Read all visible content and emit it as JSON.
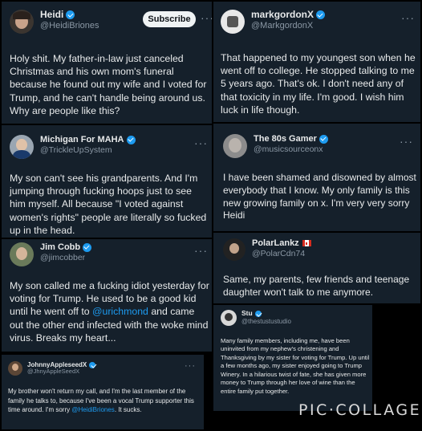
{
  "tweets": [
    {
      "name": "Heidi",
      "handle": "@HeidiBriones",
      "subscribe": "Subscribe",
      "text": "Holy shit. My father-in-law just canceled Christmas and his own mom's funeral because he found out my wife and I voted for Trump, and he can't handle being around us. Why are people like this?"
    },
    {
      "name": "markgordonX",
      "handle": "@MarkgordonX",
      "text": "That happened to my youngest son when he went off to college. He stopped talking to me 5 years ago. That's ok. I don't need any of that toxicity in my life. I'm good. I wish him luck in life though."
    },
    {
      "name": "Michigan For MAHA",
      "handle": "@TrickleUpSystem",
      "text": "My son can't see his grandparents. And I'm jumping through fucking hoops just to see him myself. All because \"I voted against women's rights\" people are literally so fucked up in the head."
    },
    {
      "name": "The 80s Gamer",
      "handle": "@musicsourceonx",
      "text": "I have been shamed and disowned by almost everybody that I know. My only family is this new growing family on x. I'm very very sorry Heidi"
    },
    {
      "name": "Jim Cobb",
      "handle": "@jimcobber",
      "text_before": "My son called me a fucking idiot yesterday for voting for Trump. He used to be a good kid until he went off to ",
      "mention": "@urichmond",
      "text_after": " and came out the other end infected with the woke mind virus. Breaks my heart..."
    },
    {
      "name": "PolarLankz",
      "handle": "@PolarCdn74",
      "text": "Same, my parents, few friends and teenage daughter won't talk to me anymore."
    },
    {
      "name": "Stu",
      "handle": "@thestustustudio",
      "text": "Many family members, including me, have been uninvited from my nephew's christening and Thanksgiving by my sister for voting for Trump. Up until a few months ago, my sister enjoyed going to Trump Winery. In a hilarious twist of fate, she has given more money to Trump through her love of wine than the entire family put together."
    },
    {
      "name": "JohnnyAppleseedX",
      "handle": "@JhnyAppleSeedX",
      "text_before": "My brother won't return my call, and I'm the last member of the family he talks to, because I've been a vocal Trump supporter this time around. I'm sorry ",
      "mention": "@HeidiBriones",
      "text_after": ". It sucks."
    }
  ],
  "more_glyph": "···",
  "watermark": "PIC·COLLAGE",
  "colors": {
    "card_bg": "#15202b",
    "link": "#1d9bf0",
    "verified": "#1d9bf0"
  }
}
